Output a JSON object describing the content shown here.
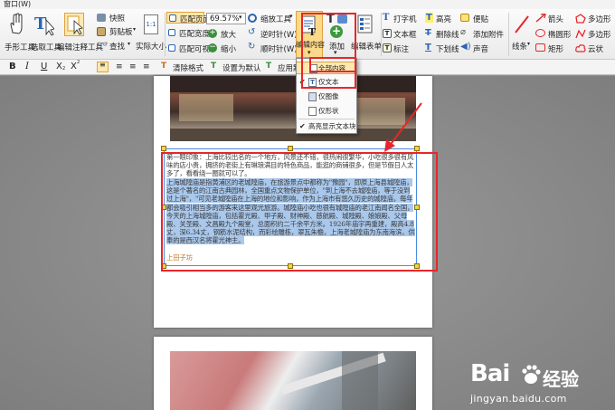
{
  "menubar": {
    "items": [
      "窗口(W)"
    ]
  },
  "ribbon": {
    "hand_tool": "手形工具",
    "select_text_tool": "选取工具",
    "edit_annotation_tool": "编辑注释工具",
    "snapshot": "快照",
    "clipboard": "剪贴板",
    "find": "查找",
    "actual_size": "实际大小",
    "fit_page": "匹配页面",
    "fit_width": "匹配宽度",
    "fit_visible": "匹配可视",
    "zoom_value": "69.57%",
    "zoom_in": "放大",
    "zoom_out": "缩小",
    "zoom_tool": "缩放工具",
    "rotate_right": "逆时针(W)",
    "rotate_left": "顺时针(W)",
    "edit_content": "编辑内容",
    "add": "添加",
    "edit_form": "编辑表单",
    "typewriter": "打字机",
    "textbox": "文本框",
    "callout": "标注",
    "highlight": "高亮",
    "strikeout": "删除线",
    "underline": "下划线",
    "note": "便贴",
    "attach_file": "添加附件",
    "sound": "声音",
    "line": "线条",
    "arrow": "箭头",
    "ellipse": "椭圆形",
    "rectangle": "矩形",
    "polygon": "多边形",
    "polyline": "多边形",
    "cloud": "云状"
  },
  "format_bar": {
    "bold": "B",
    "italic": "I",
    "underline": "U",
    "subscript": "X",
    "superscript": "X",
    "clear_format": "清除格式",
    "set_default": "设置为默认",
    "apply_default": "应用默认格"
  },
  "dropdown": {
    "items": [
      {
        "label": "全部内容",
        "checked": false,
        "highlighted": true
      },
      {
        "label": "仅文本",
        "checked": true,
        "highlighted": false
      },
      {
        "label": "仅图像",
        "checked": false,
        "highlighted": false
      },
      {
        "label": "仅形状",
        "checked": false,
        "highlighted": false
      },
      {
        "label": "高亮显示文本块",
        "checked": true,
        "highlighted": false
      }
    ]
  },
  "document": {
    "para1": "第一眼印象：上海比较出名的一个地方，风景还不错，很热闹很繁华，小吃很多很有风味的店小贵，拥挤的老街上有琳琅满目的特色商品，能逛的商铺很多，但是节假日人太多了，看看绕一圈就可以了。",
    "para2": "上海城隍庙是指黄浦区的老城隍庙，在旅游景点中都称为\"豫园\"，即原上海县城隍庙，这是个著名的江南古典园林，全国重点文物保护单位，\"到上海不去城隍庙，等于没到过上海\"，\"可见老城隍庙在上海的地位和影响，作为上海市有悠久历史的城隍庙，每年都会吸引相当多的游客来这里观光旅游。城隍庙小吃也很有城隍庙的老江南闻名全国，今天的上海城隍庙，包括霍光殿、甲子殿、财神殿、慈航殿、城隍殿、娘娘殿、父母殿、关圣殿、文昌殿九个殿堂，总面积约二千余平方米。1926年庙宇再重建，殿高4.8丈，深6.34丈，钢筋水泥结构，而彩绘雕栋，翠瓦朱檐，上海老城隍庙为东南海滨，供奉的是西汉名将霍光神主。",
    "para3": "上田子坊"
  },
  "watermark": {
    "brand": "Bai",
    "brand2": "经验",
    "url": "jingyan.baidu.com"
  },
  "colors": {
    "annotation_red": "#e8262a",
    "selection": "#a9c8ec",
    "frame_blue": "#4a8de0"
  }
}
